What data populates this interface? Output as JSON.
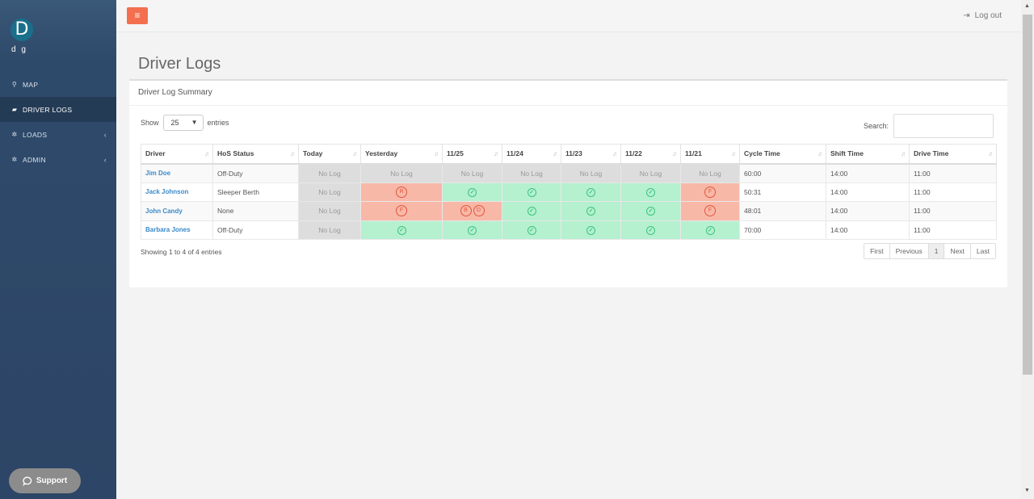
{
  "sidebar": {
    "avatar_letter": "D",
    "username": "d g",
    "items": [
      {
        "label": "MAP",
        "icon": "map-marker-icon"
      },
      {
        "label": "DRIVER LOGS",
        "icon": "book-icon",
        "active": true
      },
      {
        "label": "LOADS",
        "icon": "gear-icon",
        "has_submenu": true
      },
      {
        "label": "ADMIN",
        "icon": "gear-icon",
        "has_submenu": true
      }
    ],
    "support_label": "Support"
  },
  "topbar": {
    "menu_icon": "≡",
    "logout_label": "Log out"
  },
  "page": {
    "title": "Driver Logs",
    "panel_title": "Driver Log Summary",
    "show_label": "Show",
    "entries_value": "25",
    "entries_label": "entries",
    "search_label": "Search:",
    "info": "Showing 1 to 4 of 4 entries"
  },
  "table": {
    "columns": [
      "Driver",
      "HoS Status",
      "Today",
      "Yesterday",
      "11/25",
      "11/24",
      "11/23",
      "11/22",
      "11/21",
      "Cycle Time",
      "Shift Time",
      "Drive Time"
    ],
    "rows": [
      {
        "driver": "Jim Doe",
        "status": "Off-Duty",
        "days": [
          {
            "s": "nolog",
            "t": "No Log"
          },
          {
            "s": "nolog",
            "t": "No Log"
          },
          {
            "s": "nolog",
            "t": "No Log"
          },
          {
            "s": "nolog",
            "t": "No Log"
          },
          {
            "s": "nolog",
            "t": "No Log"
          },
          {
            "s": "nolog",
            "t": "No Log"
          },
          {
            "s": "nolog",
            "t": "No Log"
          }
        ],
        "cycle": "60:00",
        "shift": "14:00",
        "drive": "11:00"
      },
      {
        "driver": "Jack Johnson",
        "status": "Sleeper Berth",
        "days": [
          {
            "s": "nolog",
            "t": "No Log"
          },
          {
            "s": "bad",
            "flags": [
              "R"
            ]
          },
          {
            "s": "ok"
          },
          {
            "s": "ok"
          },
          {
            "s": "ok"
          },
          {
            "s": "ok"
          },
          {
            "s": "bad",
            "flags": [
              "F"
            ]
          }
        ],
        "cycle": "50:31",
        "shift": "14:00",
        "drive": "11:00"
      },
      {
        "driver": "John Candy",
        "status": "None",
        "days": [
          {
            "s": "nolog",
            "t": "No Log"
          },
          {
            "s": "bad",
            "flags": [
              "F"
            ]
          },
          {
            "s": "bad",
            "flags": [
              "B",
              "D"
            ]
          },
          {
            "s": "ok"
          },
          {
            "s": "ok"
          },
          {
            "s": "ok"
          },
          {
            "s": "bad",
            "flags": [
              "F"
            ]
          }
        ],
        "cycle": "48:01",
        "shift": "14:00",
        "drive": "11:00"
      },
      {
        "driver": "Barbara Jones",
        "status": "Off-Duty",
        "days": [
          {
            "s": "nolog",
            "t": "No Log"
          },
          {
            "s": "ok"
          },
          {
            "s": "ok"
          },
          {
            "s": "ok"
          },
          {
            "s": "ok"
          },
          {
            "s": "ok"
          },
          {
            "s": "ok"
          }
        ],
        "cycle": "70:00",
        "shift": "14:00",
        "drive": "11:00"
      }
    ]
  },
  "pager": [
    "First",
    "Previous",
    "1",
    "Next",
    "Last"
  ],
  "colors": {
    "ok": "#b5f0cf",
    "bad": "#f8b8a8",
    "nolog": "#dddddd",
    "accent": "#f36f4f"
  }
}
